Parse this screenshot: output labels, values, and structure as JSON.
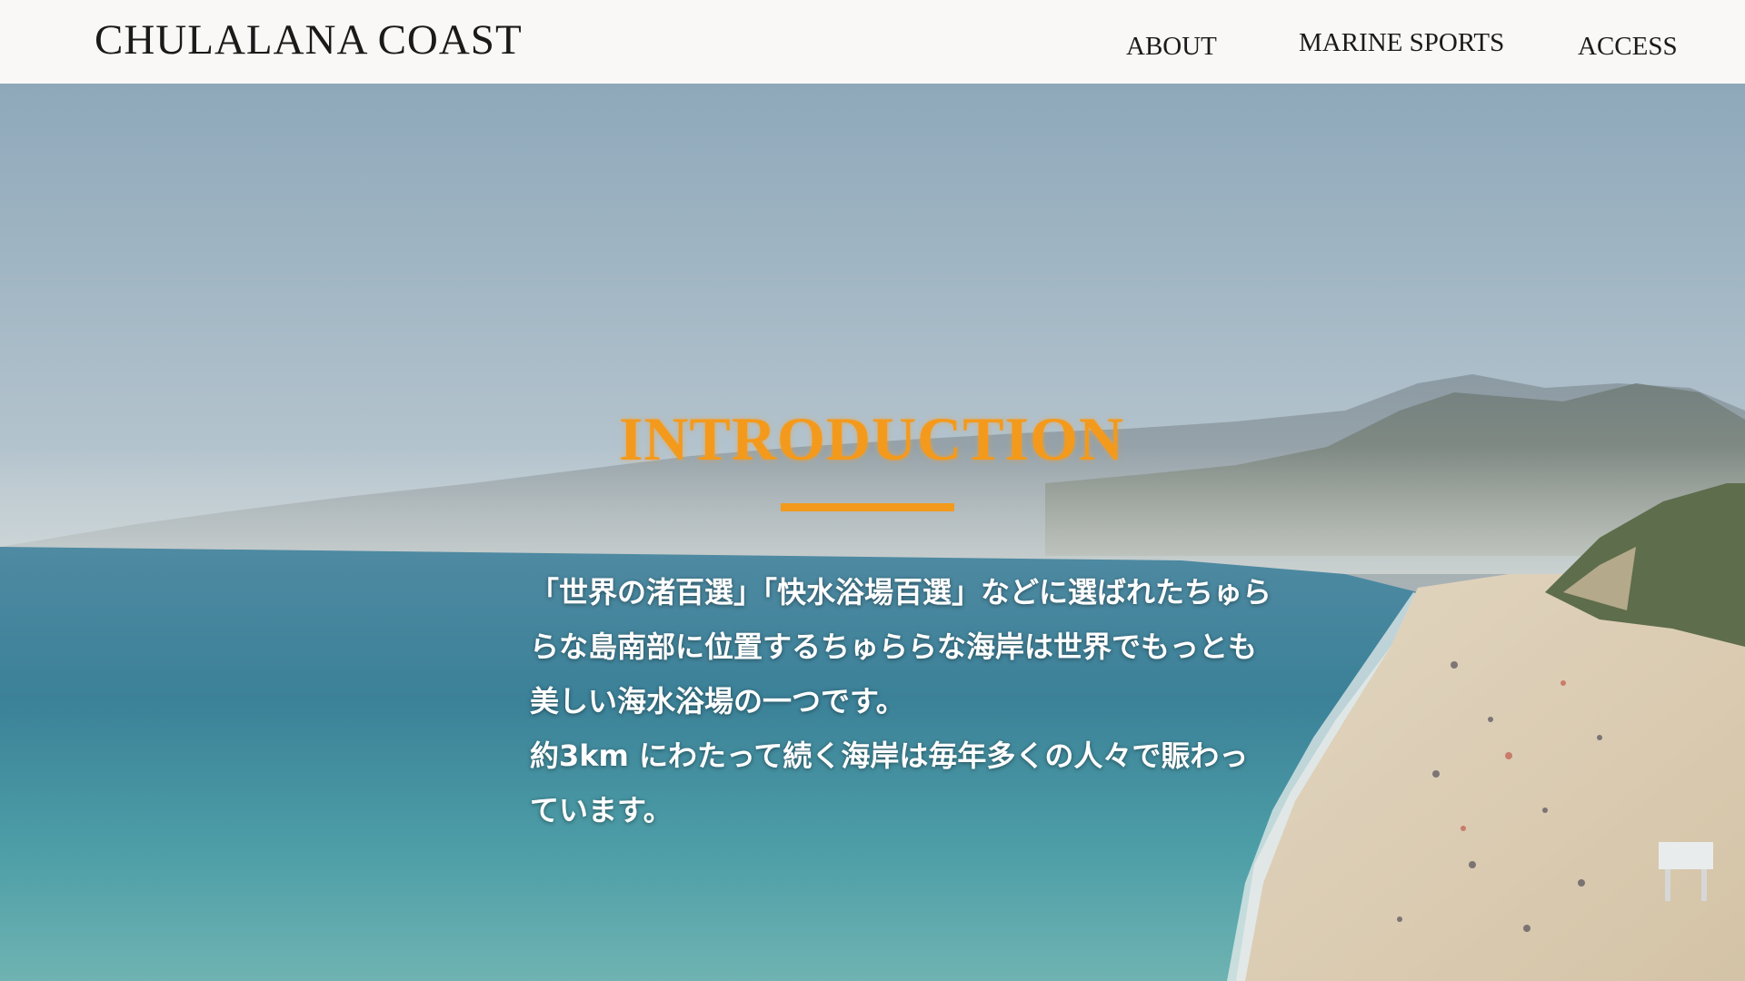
{
  "header": {
    "logo": "CHULALANA COAST",
    "nav": [
      {
        "label": "ABOUT"
      },
      {
        "label": "MARINE SPORTS"
      },
      {
        "label": "ACCESS"
      }
    ]
  },
  "hero": {
    "image": "beach-coast-photo",
    "title": "INTRODUCTION",
    "paragraph_1": "「世界の渚百選」「快水浴場百選」などに選ばれたちゅららな島南部に位置するちゅららな海岸は世界でもっとも美しい海水浴場の一つです。",
    "paragraph_2": "約3km にわたって続く海岸は毎年多くの人々で賑わっています。"
  },
  "colors": {
    "accent": "#f39a1d",
    "header_bg": "#f9f8f6",
    "text_dark": "#1a1a1a",
    "text_light": "#ffffff"
  }
}
